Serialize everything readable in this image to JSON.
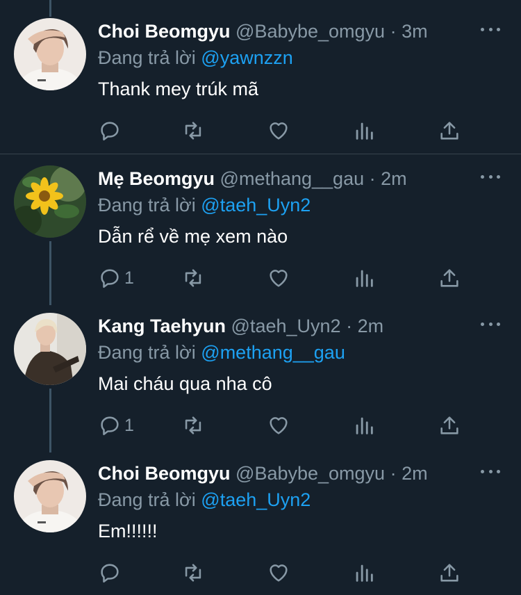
{
  "reply_prefix": "Đang trả lời",
  "tweets": [
    {
      "name": "Choi Beomgyu",
      "handle": "@Babybe_omgyu",
      "time": "3m",
      "reply_to": "@yawnzzn",
      "text": "Thank mey trúk mã",
      "reply_count": "",
      "avatar": "person-hand-on-forehead-avatar"
    },
    {
      "name": "Mẹ Beomgyu",
      "handle": "@methang__gau",
      "time": "2m",
      "reply_to": "@taeh_Uyn2",
      "text": "Dẫn rể về mẹ xem nào",
      "reply_count": "1",
      "avatar": "yellow-flower-avatar"
    },
    {
      "name": "Kang Taehyun",
      "handle": "@taeh_Uyn2",
      "time": "2m",
      "reply_to": "@methang__gau",
      "text": "Mai cháu qua nha cô",
      "reply_count": "1",
      "avatar": "person-dark-jacket-avatar"
    },
    {
      "name": "Choi Beomgyu",
      "handle": "@Babybe_omgyu",
      "time": "2m",
      "reply_to": "@taeh_Uyn2",
      "text": "Em!!!!!!",
      "reply_count": "",
      "avatar": "person-hand-on-forehead-avatar"
    }
  ],
  "colors": {
    "background": "#15202b",
    "name": "#ffffff",
    "muted": "#8899a6",
    "mention": "#1da1f2",
    "divider": "#38444d"
  }
}
